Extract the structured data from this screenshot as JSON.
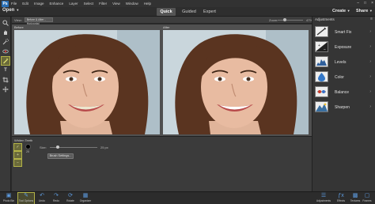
{
  "menubar": {
    "logo": "Ps",
    "items": [
      "File",
      "Edit",
      "Image",
      "Enhance",
      "Layer",
      "Select",
      "Filter",
      "View",
      "Window",
      "Help"
    ],
    "window_buttons": [
      "–",
      "□",
      "×"
    ]
  },
  "modebar": {
    "open_label": "Open",
    "tabs": [
      "Quick",
      "Guided",
      "Expert"
    ],
    "active_tab": "Quick",
    "create_label": "Create",
    "share_label": "Share"
  },
  "options": {
    "view_label": "View:",
    "view_value": "Before & After - Horizontal",
    "zoom_label": "Zoom:",
    "zoom_value": "47%",
    "zoom_fraction": 0.25
  },
  "canvas": {
    "before_label": "Before",
    "after_label": "After"
  },
  "tool_options": {
    "title": "Whiten Teeth",
    "brush_number": "25",
    "size_label": "Size:",
    "size_value": "25 px",
    "size_fraction": 0.15,
    "brush_settings_label": "Brush Settings..."
  },
  "adjustments": {
    "title": "Adjustments",
    "items": [
      {
        "label": "Smart Fix",
        "icon": "smart-fix-icon"
      },
      {
        "label": "Exposure",
        "icon": "exposure-icon"
      },
      {
        "label": "Levels",
        "icon": "levels-icon"
      },
      {
        "label": "Color",
        "icon": "color-icon"
      },
      {
        "label": "Balance",
        "icon": "balance-icon"
      },
      {
        "label": "Sharpen",
        "icon": "sharpen-icon"
      }
    ]
  },
  "bottombar": {
    "left": [
      {
        "label": "Photo Bin",
        "icon": "photo-bin-icon"
      },
      {
        "label": "Tool Options",
        "icon": "tool-options-icon"
      },
      {
        "label": "Undo",
        "icon": "undo-icon"
      },
      {
        "label": "Redo",
        "icon": "redo-icon"
      },
      {
        "label": "Rotate",
        "icon": "rotate-icon"
      },
      {
        "label": "Organizer",
        "icon": "organizer-icon"
      }
    ],
    "right": [
      {
        "label": "Adjustments",
        "icon": "adjustments-icon"
      },
      {
        "label": "Effects",
        "icon": "effects-icon"
      },
      {
        "label": "Textures",
        "icon": "textures-icon"
      },
      {
        "label": "Frames",
        "icon": "frames-icon"
      }
    ]
  },
  "colors": {
    "accent_blue": "#2a6fb5",
    "highlight": "#b3b347",
    "panel_dark": "#353535"
  }
}
